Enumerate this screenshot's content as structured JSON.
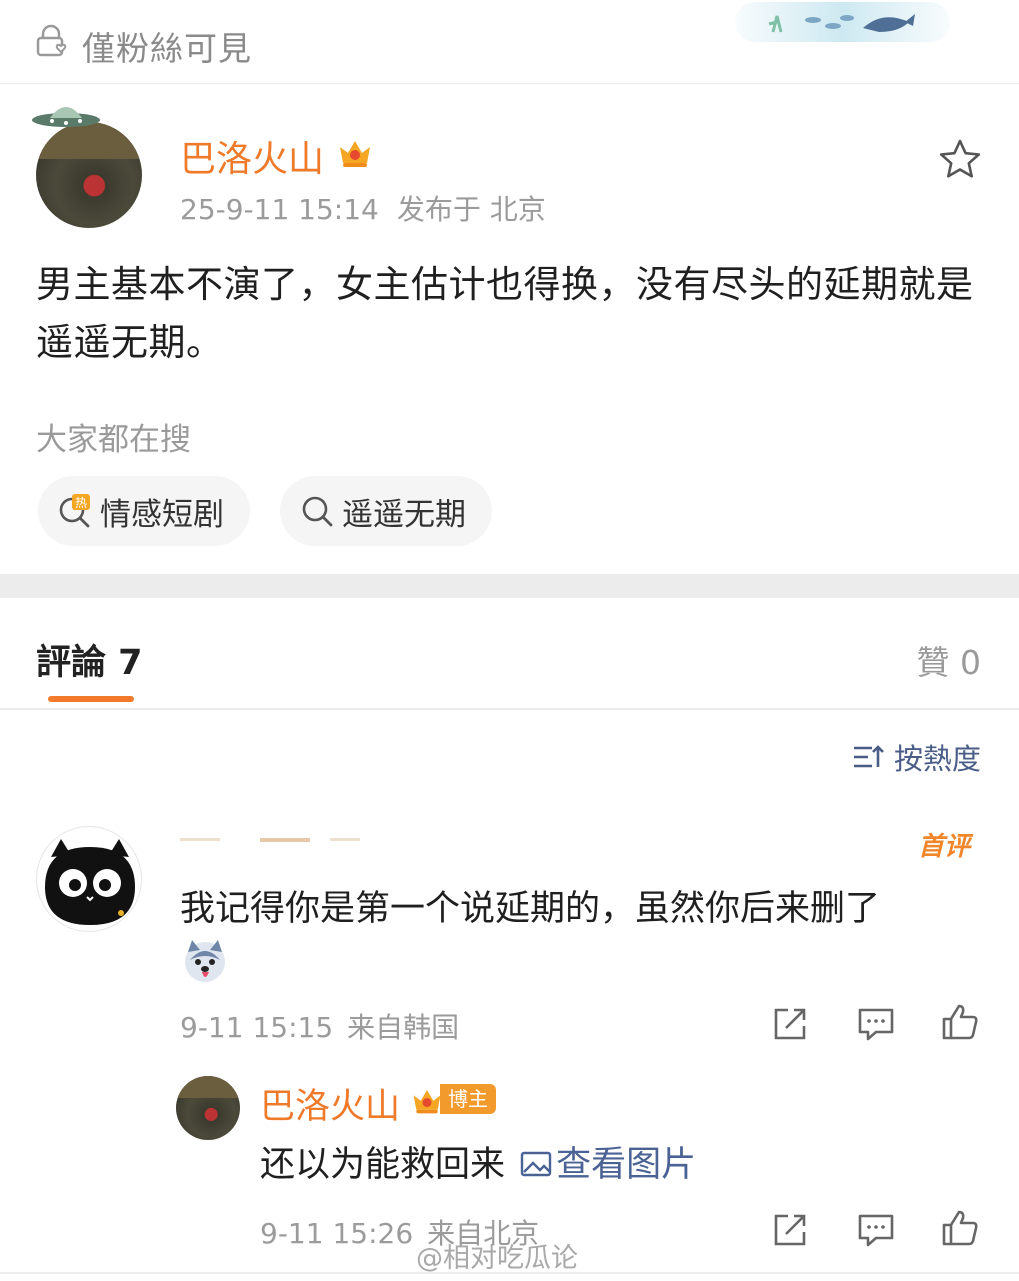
{
  "topbar": {
    "visibility_text": "僅粉絲可見"
  },
  "post": {
    "author": "巴洛火山",
    "date": "25-9-11 15:14",
    "location": "发布于 北京",
    "body": "男主基本不演了，女主估计也得换，没有尽头的延期就是遥遥无期。"
  },
  "search": {
    "title": "大家都在搜",
    "chips": [
      {
        "label": "情感短剧",
        "icon": "hot-search-icon"
      },
      {
        "label": "遥遥无期",
        "icon": "search-icon"
      }
    ]
  },
  "tabs": {
    "comments_label": "評論 7",
    "likes_label": "贊 0"
  },
  "sort": {
    "label": "按熱度"
  },
  "comments": [
    {
      "badge": "首评",
      "text": "我记得你是第一个说延期的，虽然你后来删了",
      "date": "9-11 15:15",
      "location": "来自韩国",
      "reply": {
        "author": "巴洛火山",
        "author_tag": "博主",
        "text": "还以为能救回来",
        "link_text": "查看图片",
        "date": "9-11 15:26",
        "location": "来自北京"
      }
    }
  ],
  "watermark": "@相对吃瓜论",
  "colors": {
    "accent_orange": "#ee7a2a",
    "link_blue": "#4a6294",
    "meta_gray": "#9b9b9b"
  }
}
